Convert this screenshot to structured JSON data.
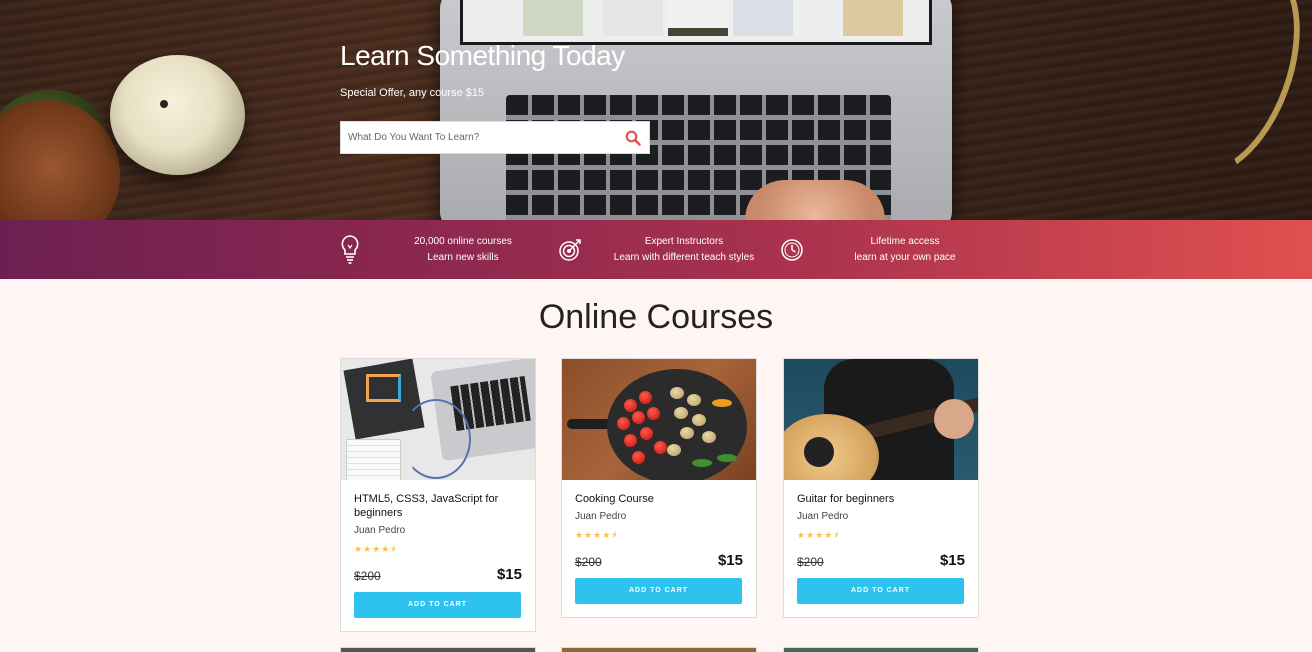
{
  "hero": {
    "title": "Learn Something Today",
    "subtitle": "Special Offer, any course $15",
    "search_placeholder": "What Do You Want To Learn?"
  },
  "features": [
    {
      "icon": "lightbulb-icon",
      "line1": "20,000 online courses",
      "line2": "Learn new skills"
    },
    {
      "icon": "target-icon",
      "line1": "Expert Instructors",
      "line2": "Learn with different teach styles"
    },
    {
      "icon": "clock-icon",
      "line1": "Lifetime access",
      "line2": "learn at your own pace"
    }
  ],
  "section_title": "Online Courses",
  "courses": [
    {
      "title": "HTML5, CSS3, JavaScript for beginners",
      "author": "Juan Pedro",
      "rating": 4.5,
      "old_price": "$200",
      "price": "$15",
      "button": "ADD TO CART",
      "image": "html-css-workspace"
    },
    {
      "title": "Cooking Course",
      "author": "Juan Pedro",
      "rating": 4.5,
      "old_price": "$200",
      "price": "$15",
      "button": "ADD TO CART",
      "image": "vegetables-pan"
    },
    {
      "title": "Guitar for beginners",
      "author": "Juan Pedro",
      "rating": 4.5,
      "old_price": "$200",
      "price": "$15",
      "button": "ADD TO CART",
      "image": "acoustic-guitar"
    }
  ],
  "colors": {
    "accent": "#2ec2ef",
    "bar_start": "#6c2051",
    "bar_end": "#e0504f",
    "star": "#f4c150",
    "search_icon": "#e2504f"
  }
}
